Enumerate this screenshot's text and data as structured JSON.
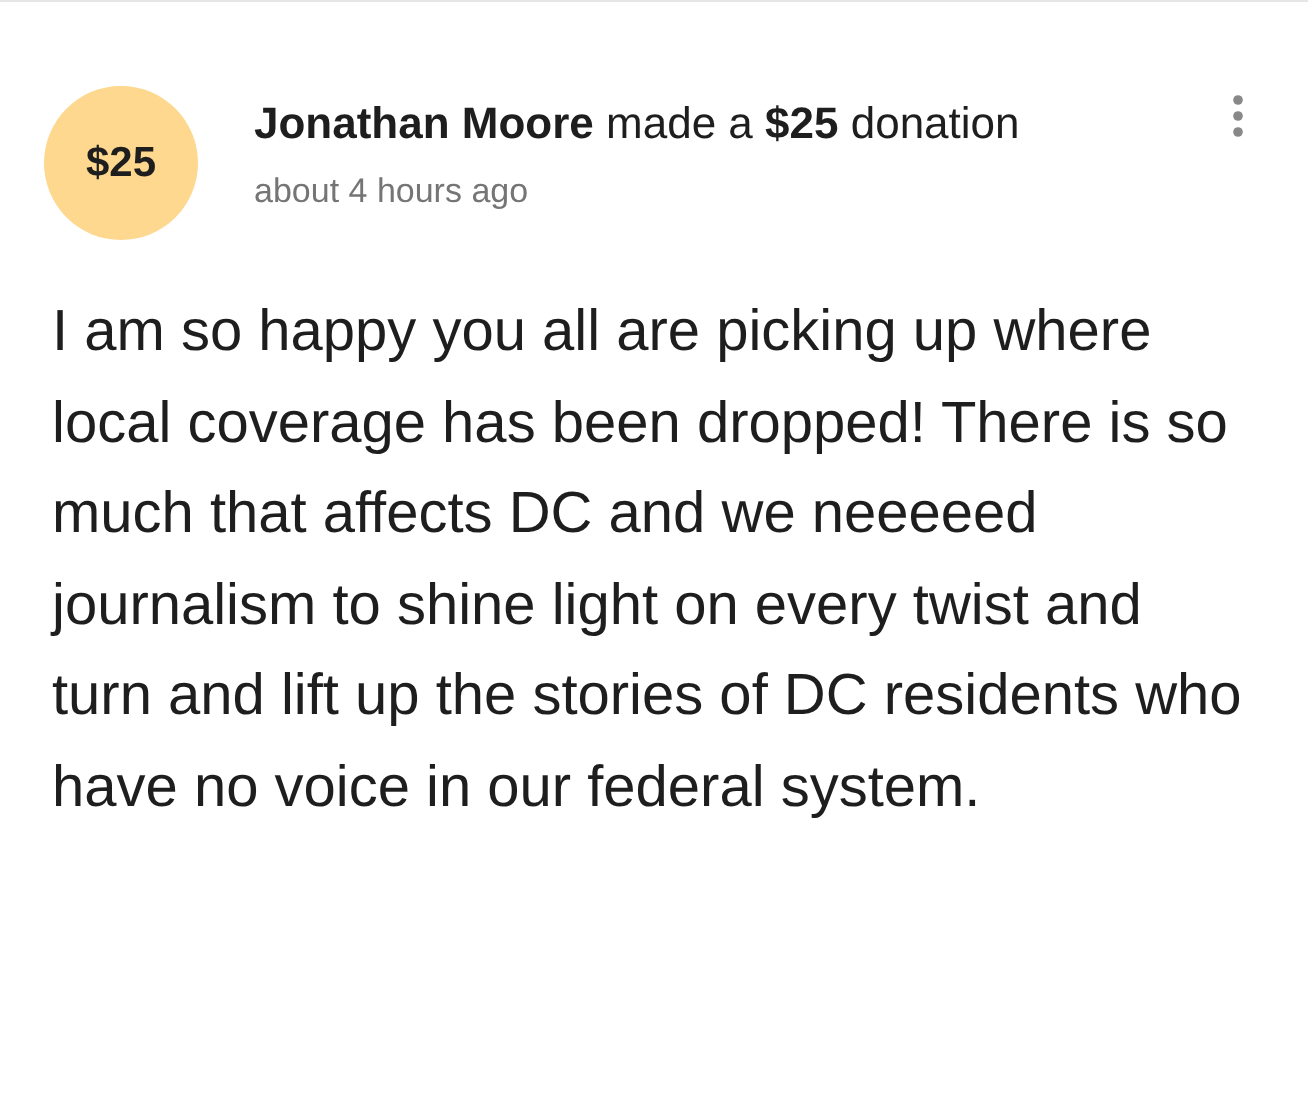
{
  "donation": {
    "badge": "$25",
    "headline": "**Jonathan Moore** made a **$25** donation",
    "time": "about 4 hours ago"
  },
  "message": "I am so happy you all are picking up where local coverage has been dropped! There is so much that affects DC and we neeeeed journalism to shine light on every twist and turn and lift up the stories of DC residents who have no voice in our federal system."
}
